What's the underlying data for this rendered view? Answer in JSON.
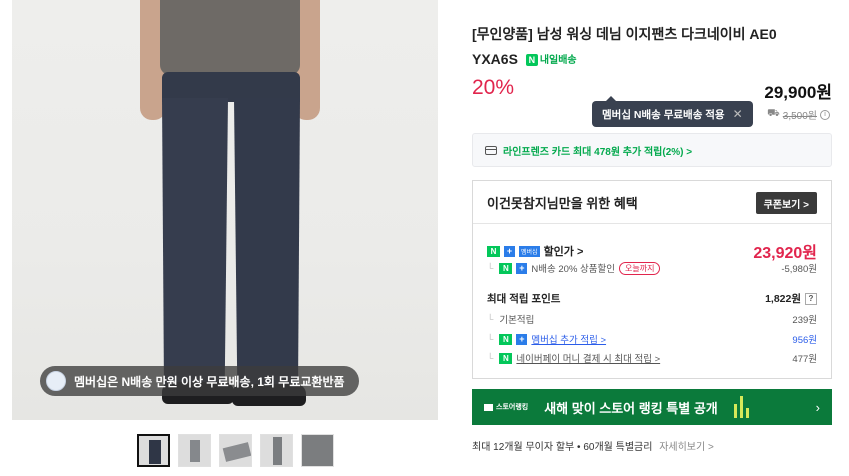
{
  "product": {
    "title_line1": "[무인양품] 남성 워싱 데님 이지팬츠 다크네이비 AE0",
    "title_line2": "YXA6S",
    "delivery_badge": "내일배송",
    "discount": "20%",
    "price": "29,900원",
    "original_price": "3,500원",
    "tooltip": "멤버십 N배송 무료배송 적용"
  },
  "gallery": {
    "promo_text": "멤버십은 N배송 만원 이상 무료배송, 1회 무료교환반품",
    "thumbnails": [
      "정면 착용",
      "측면 착용",
      "평면 이미지",
      "측면 제품",
      "원단 상세"
    ]
  },
  "card_offer": "라인프렌즈 카드 최대 478원 추가 적립(2%) >",
  "benefits": {
    "heading": "이건못참지님만을 위한 혜택",
    "coupon_button": "쿠폰보기 >",
    "sale_label": "할인가 >",
    "sale_price": "23,920원",
    "n_delivery_label": "N배송 20% 상품할인",
    "today_badge": "오늘까지",
    "n_delivery_amount": "-5,980원",
    "points_label": "최대 적립 포인트",
    "points_amount": "1,822원",
    "basic_label": "기본적립",
    "basic_amount": "239원",
    "membership_label": "멤버십 추가 적립 >",
    "membership_amount": "956원",
    "npay_label": "네이버페이 머니 결제 시 최대 적립 >",
    "npay_amount": "477원"
  },
  "banner": {
    "small": "스토어랭킹",
    "big": "새해 맞이 스토어 랭킹 특별 공개",
    "arrow": "›"
  },
  "installment": {
    "text": "최대 12개월 무이자 할부 • 60개월 특별금리",
    "more": "자세히보기 >"
  },
  "colors": {
    "accent_red": "#e1254d",
    "naver_green": "#03c75a",
    "banner_green": "#0b7a3b"
  }
}
